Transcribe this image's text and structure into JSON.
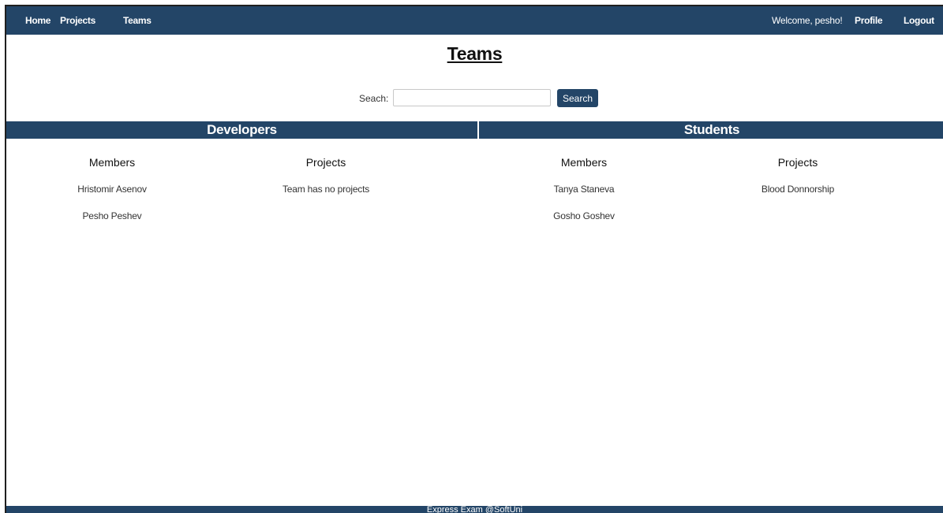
{
  "nav": {
    "home": "Home",
    "projects": "Projects",
    "teams": "Teams",
    "welcome": "Welcome, pesho!",
    "profile": "Profile",
    "logout": "Logout"
  },
  "page": {
    "title": "Teams"
  },
  "search": {
    "label": "Seach:",
    "value": "",
    "button": "Search"
  },
  "teams": [
    {
      "name": "Developers",
      "members_heading": "Members",
      "projects_heading": "Projects",
      "members": [
        "Hristomir Asenov",
        "Pesho Peshev"
      ],
      "projects": [
        "Team has no projects"
      ]
    },
    {
      "name": "Students",
      "members_heading": "Members",
      "projects_heading": "Projects",
      "members": [
        "Tanya Staneva",
        "Gosho Goshev"
      ],
      "projects": [
        "Blood Donnorship"
      ]
    }
  ],
  "footer": {
    "text": "Express Exam @SoftUni"
  },
  "colors": {
    "navbar": "#234567",
    "page_background": "#ffffff"
  }
}
